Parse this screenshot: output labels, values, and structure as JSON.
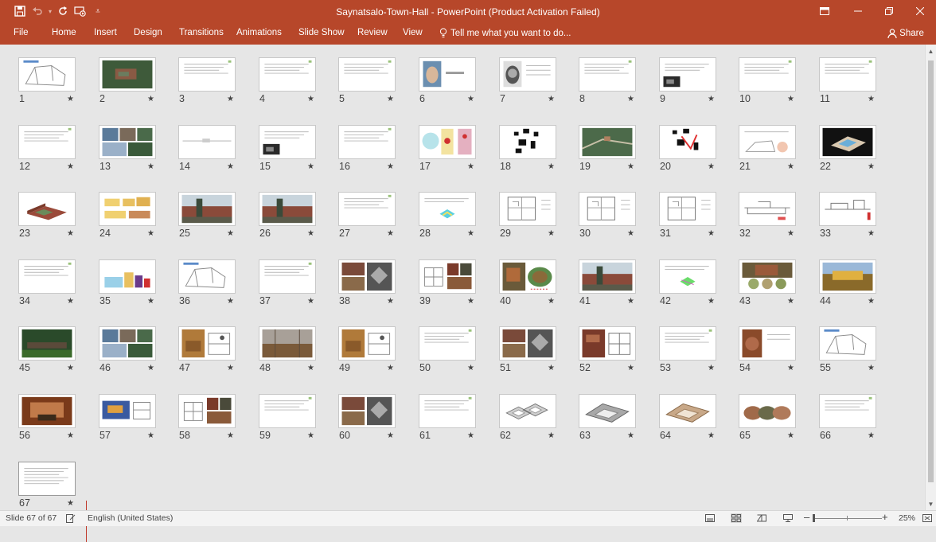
{
  "window": {
    "title": "Saynatsalo-Town-Hall - PowerPoint (Product Activation Failed)",
    "minimize_icon": "minimize-icon",
    "restore_icon": "restore-icon",
    "close_icon": "close-icon",
    "ribbon_options_icon": "ribbon-display-options-icon"
  },
  "quick_access": {
    "icons": [
      "save-icon",
      "undo-icon",
      "redo-icon",
      "start-from-beginning-icon",
      "customize-quick-access-icon"
    ]
  },
  "ribbon": {
    "tabs": [
      "File",
      "Home",
      "Insert",
      "Design",
      "Transitions",
      "Animations",
      "Slide Show",
      "Review",
      "View"
    ],
    "tell_me": "Tell me what you want to do...",
    "share": "Share"
  },
  "status": {
    "slide_info": "Slide 67 of 67",
    "language": "English (United States)",
    "zoom": "25%",
    "minus": "–",
    "plus": "+"
  },
  "slides": [
    {
      "n": "1",
      "style": "sketch"
    },
    {
      "n": "2",
      "style": "photo-green"
    },
    {
      "n": "3",
      "style": "text"
    },
    {
      "n": "4",
      "style": "text"
    },
    {
      "n": "5",
      "style": "text"
    },
    {
      "n": "6",
      "style": "portrait"
    },
    {
      "n": "7",
      "style": "portrait-bw"
    },
    {
      "n": "8",
      "style": "text"
    },
    {
      "n": "9",
      "style": "text-photo"
    },
    {
      "n": "10",
      "style": "text"
    },
    {
      "n": "11",
      "style": "text"
    },
    {
      "n": "12",
      "style": "text"
    },
    {
      "n": "13",
      "style": "photo-grid"
    },
    {
      "n": "14",
      "style": "line"
    },
    {
      "n": "15",
      "style": "text-photo"
    },
    {
      "n": "16",
      "style": "text"
    },
    {
      "n": "17",
      "style": "maps"
    },
    {
      "n": "18",
      "style": "bw-plan"
    },
    {
      "n": "19",
      "style": "aerial"
    },
    {
      "n": "20",
      "style": "bw-plan-red"
    },
    {
      "n": "21",
      "style": "sketch-pink"
    },
    {
      "n": "22",
      "style": "model-dark"
    },
    {
      "n": "23",
      "style": "model"
    },
    {
      "n": "24",
      "style": "elevation-yellow"
    },
    {
      "n": "25",
      "style": "photo-brick"
    },
    {
      "n": "26",
      "style": "photo-brick"
    },
    {
      "n": "27",
      "style": "text"
    },
    {
      "n": "28",
      "style": "diagram-cyan"
    },
    {
      "n": "29",
      "style": "plan"
    },
    {
      "n": "30",
      "style": "plan"
    },
    {
      "n": "31",
      "style": "plan"
    },
    {
      "n": "32",
      "style": "section"
    },
    {
      "n": "33",
      "style": "section-red"
    },
    {
      "n": "34",
      "style": "text"
    },
    {
      "n": "35",
      "style": "section-color"
    },
    {
      "n": "36",
      "style": "sketch"
    },
    {
      "n": "37",
      "style": "text"
    },
    {
      "n": "38",
      "style": "photo-grid-dark"
    },
    {
      "n": "39",
      "style": "plan-photos"
    },
    {
      "n": "40",
      "style": "photo-circle"
    },
    {
      "n": "41",
      "style": "photo-brick"
    },
    {
      "n": "42",
      "style": "diagram-green"
    },
    {
      "n": "43",
      "style": "photo-circles"
    },
    {
      "n": "44",
      "style": "photo-yellow"
    },
    {
      "n": "45",
      "style": "photo-forest"
    },
    {
      "n": "46",
      "style": "photo-grid"
    },
    {
      "n": "47",
      "style": "photo-wood"
    },
    {
      "n": "48",
      "style": "photo-interior"
    },
    {
      "n": "49",
      "style": "photo-wood"
    },
    {
      "n": "50",
      "style": "text"
    },
    {
      "n": "51",
      "style": "photo-grid-dark"
    },
    {
      "n": "52",
      "style": "photo-brick-plan"
    },
    {
      "n": "53",
      "style": "text"
    },
    {
      "n": "54",
      "style": "photo-detail"
    },
    {
      "n": "55",
      "style": "sketch"
    },
    {
      "n": "56",
      "style": "photo-red"
    },
    {
      "n": "57",
      "style": "photo-blue"
    },
    {
      "n": "58",
      "style": "plan-photos"
    },
    {
      "n": "59",
      "style": "text"
    },
    {
      "n": "60",
      "style": "photo-grid-dark"
    },
    {
      "n": "61",
      "style": "text"
    },
    {
      "n": "62",
      "style": "axo"
    },
    {
      "n": "63",
      "style": "axo-brick"
    },
    {
      "n": "64",
      "style": "axo-tan"
    },
    {
      "n": "65",
      "style": "photo-circles-brown"
    },
    {
      "n": "66",
      "style": "text"
    },
    {
      "n": "67",
      "style": "text-list"
    }
  ]
}
